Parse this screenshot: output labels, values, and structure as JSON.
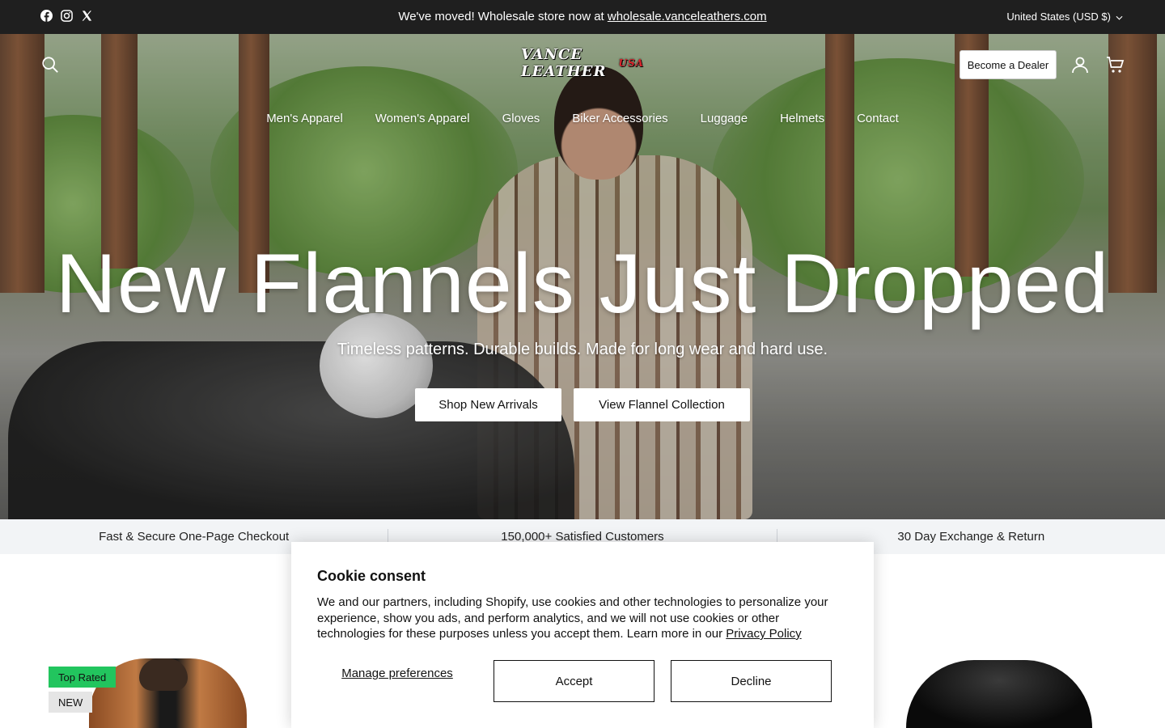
{
  "topbar": {
    "social": [
      "facebook-icon",
      "instagram-icon",
      "x-icon"
    ],
    "announcement_prefix": "We've moved! Wholesale store now at ",
    "announcement_link": "wholesale.vanceleathers.com",
    "currency": "United States (USD $)"
  },
  "header": {
    "logo_text": "VANCE LEATHER",
    "logo_badge": "USA",
    "dealer_label": "Become a Dealer"
  },
  "nav": [
    "Men's Apparel",
    "Women's Apparel",
    "Gloves",
    "Biker Accessories",
    "Luggage",
    "Helmets",
    "Contact"
  ],
  "hero": {
    "title": "New Flannels Just Dropped",
    "subtitle": "Timeless patterns. Durable builds. Made for long wear and hard use.",
    "cta_primary": "Shop New Arrivals",
    "cta_secondary": "View Flannel Collection"
  },
  "features": [
    "Fast & Secure One-Page Checkout",
    "150,000+ Satisfied Customers",
    "30 Day Exchange & Return"
  ],
  "products": {
    "badge_top_rated": "Top Rated",
    "badge_new": "NEW"
  },
  "cookie": {
    "title": "Cookie consent",
    "body": "We and our partners, including Shopify, use cookies and other technologies to personalize your experience, show you ads, and perform analytics, and we will not use cookies or other technologies for these purposes unless you accept them. Learn more in our ",
    "policy_link": "Privacy Policy",
    "manage_label": "Manage preferences",
    "accept_label": "Accept",
    "decline_label": "Decline"
  },
  "colors": {
    "topbar_bg": "#1f1f1f",
    "feature_strip_bg": "#f2f4f6",
    "badge_top_rated_bg": "#22c55e",
    "badge_new_bg": "#e5e5e5"
  }
}
